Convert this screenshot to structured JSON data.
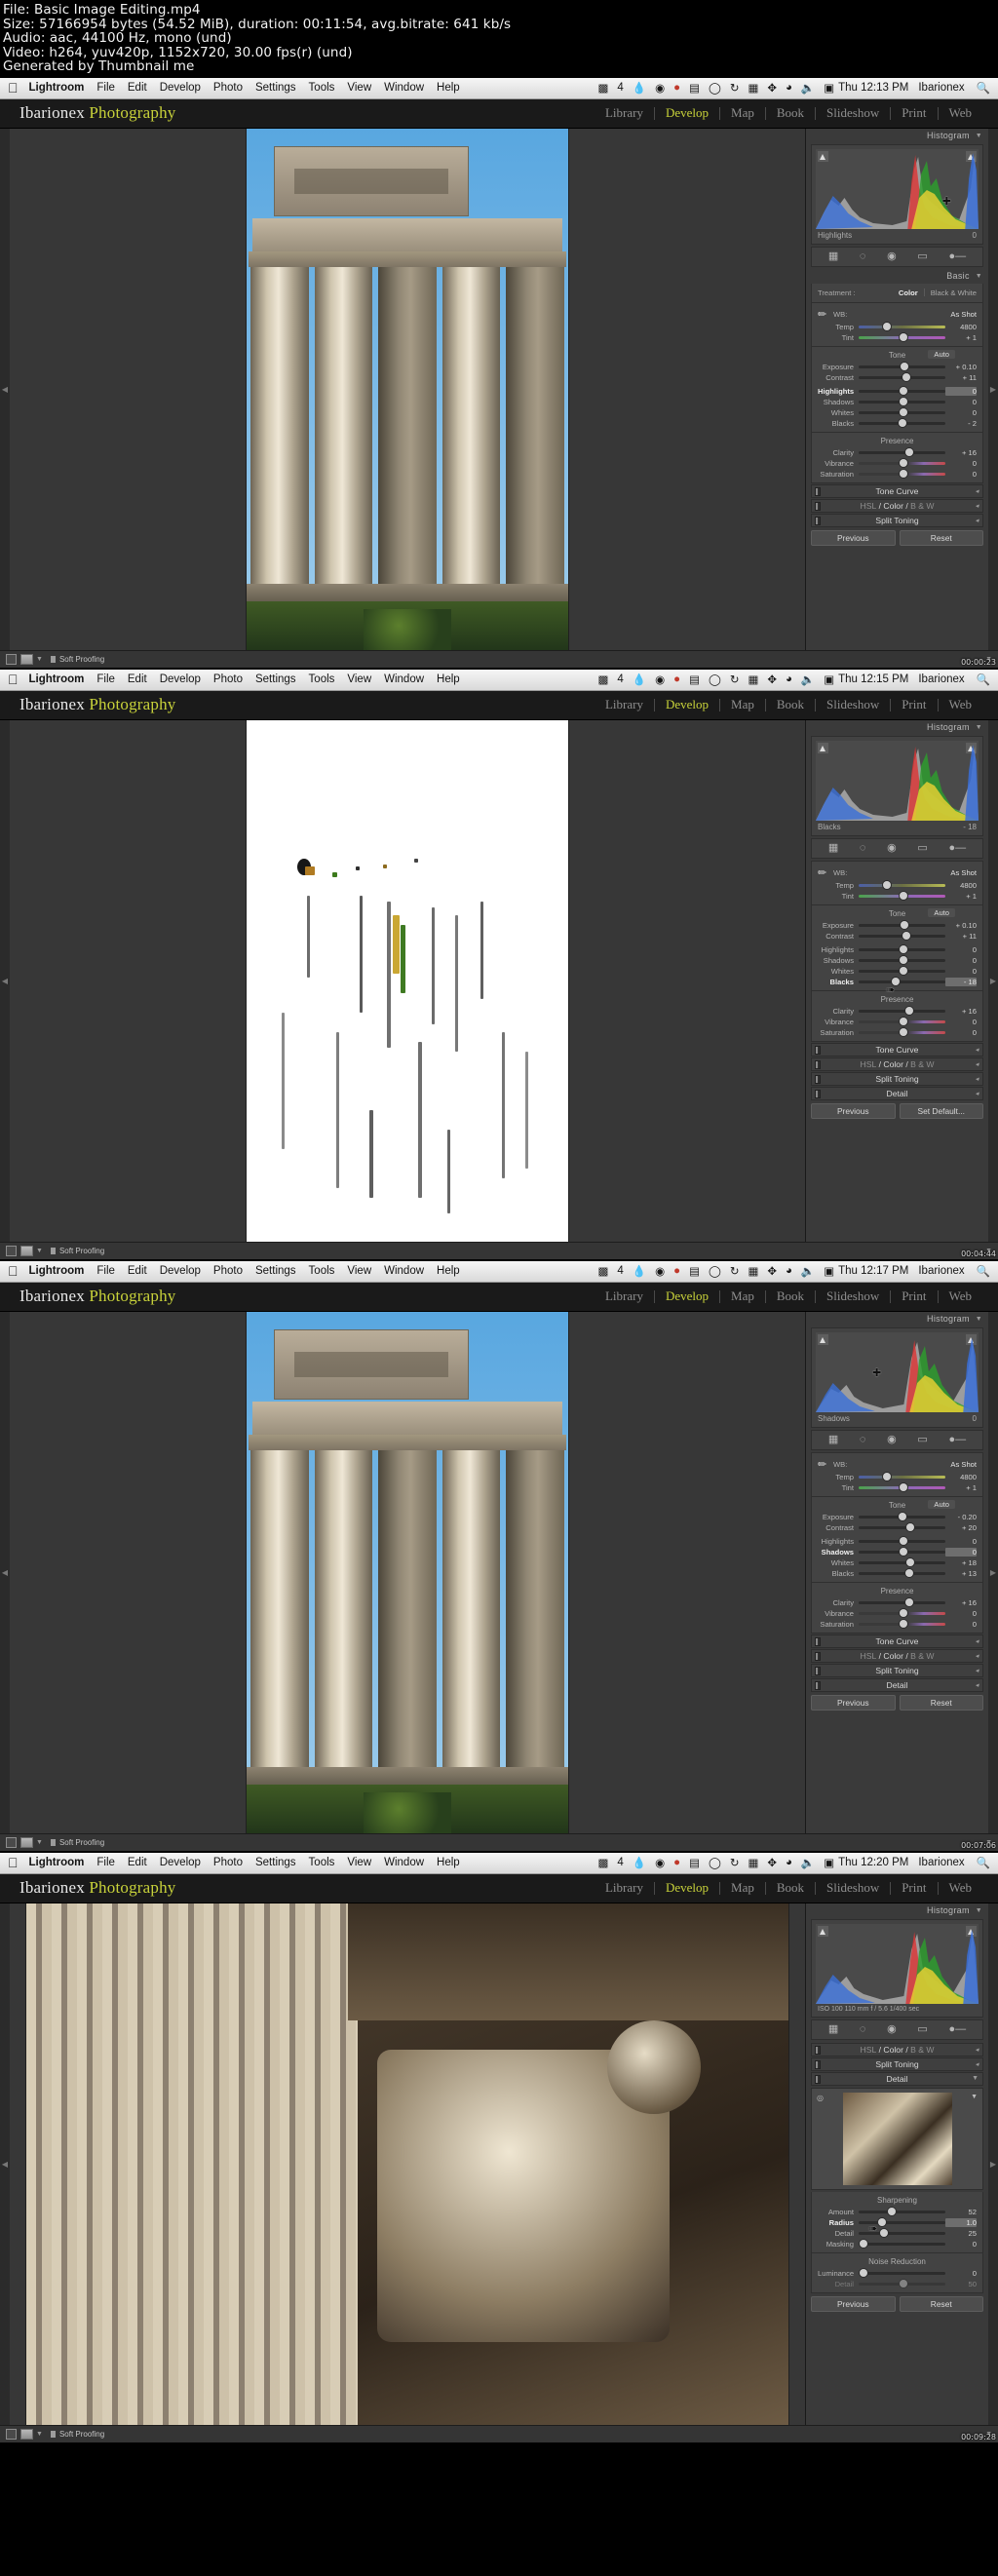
{
  "header": {
    "lines": [
      "File: Basic Image Editing.mp4",
      "Size: 57166954 bytes (54.52 MiB), duration: 00:11:54, avg.bitrate: 641 kb/s",
      "Audio: aac, 44100 Hz, mono (und)",
      "Video: h264, yuv420p, 1152x720, 30.00 fps(r) (und)",
      "Generated by Thumbnail me"
    ]
  },
  "macbar": {
    "apple": "apple-logo",
    "menus": [
      "Lightroom",
      "File",
      "Edit",
      "Develop",
      "Photo",
      "Settings",
      "Tools",
      "View",
      "Window",
      "Help"
    ],
    "tray_count": "4",
    "user": "Ibarionex",
    "search_icon": "search-icon"
  },
  "identity": {
    "word1": "Ibarionex",
    "word2": "Photography"
  },
  "modules": {
    "items": [
      "Library",
      "Develop",
      "Map",
      "Book",
      "Slideshow",
      "Print",
      "Web"
    ],
    "active": "Develop"
  },
  "labels": {
    "histogram": "Histogram",
    "basic": "Basic",
    "treatment": "Treatment :",
    "color": "Color",
    "bw": "Black & White",
    "wb": "WB:",
    "as_shot": "As Shot",
    "tone": "Tone",
    "auto": "Auto",
    "presence": "Presence",
    "temp": "Temp",
    "tint": "Tint",
    "exposure": "Exposure",
    "contrast": "Contrast",
    "highlights": "Highlights",
    "shadows": "Shadows",
    "whites": "Whites",
    "blacks": "Blacks",
    "clarity": "Clarity",
    "vibrance": "Vibrance",
    "saturation": "Saturation",
    "tone_curve": "Tone Curve",
    "hsl": "HSL",
    "bw_short": "B & W",
    "split_toning": "Split Toning",
    "detail": "Detail",
    "sharpening": "Sharpening",
    "amount": "Amount",
    "radius": "Radius",
    "detail_slider": "Detail",
    "masking": "Masking",
    "noise_reduction": "Noise Reduction",
    "luminance": "Luminance",
    "soft_proofing": "Soft Proofing",
    "previous": "Previous",
    "reset": "Reset",
    "set_default": "Set Default..."
  },
  "panels": [
    {
      "id": "panel-1",
      "clock": "Thu 12:13 PM",
      "timestamp": "00:00:23",
      "histogram_readout_label": "Highlights",
      "histogram_readout_value": "0",
      "photo": "columns-building",
      "basic": {
        "temp": "4800",
        "tint": "+ 1",
        "exposure": "+ 0.10",
        "contrast": "+ 11",
        "highlights": "0",
        "shadows": "0",
        "whites": "0",
        "blacks": "- 2",
        "clarity": "+ 16",
        "vibrance": "0",
        "saturation": "0",
        "highlighted_row": "highlights"
      },
      "footer_buttons": [
        "Previous",
        "Reset"
      ]
    },
    {
      "id": "panel-2",
      "clock": "Thu 12:15 PM",
      "timestamp": "00:04:44",
      "histogram_readout_label": "Blacks",
      "histogram_readout_value": "- 18",
      "photo": "clipping-preview",
      "basic": {
        "temp": "4800",
        "tint": "+ 1",
        "exposure": "+ 0.10",
        "contrast": "+ 11",
        "highlights": "0",
        "shadows": "0",
        "whites": "0",
        "blacks": "- 18",
        "clarity": "+ 16",
        "vibrance": "0",
        "saturation": "0",
        "highlighted_row": "blacks"
      },
      "footer_buttons": [
        "Previous",
        "Set Default..."
      ]
    },
    {
      "id": "panel-3",
      "clock": "Thu 12:17 PM",
      "timestamp": "00:07:06",
      "histogram_readout_label": "Shadows",
      "histogram_readout_value": "0",
      "photo": "columns-building",
      "basic": {
        "temp": "4800",
        "tint": "+ 1",
        "exposure": "- 0.20",
        "contrast": "+ 20",
        "highlights": "0",
        "shadows": "0",
        "whites": "+ 18",
        "blacks": "+ 13",
        "clarity": "+ 16",
        "vibrance": "0",
        "saturation": "0",
        "highlighted_row": "shadows"
      },
      "footer_buttons": [
        "Previous",
        "Reset"
      ]
    },
    {
      "id": "panel-4",
      "clock": "Thu 12:20 PM",
      "timestamp": "00:09:28",
      "histogram_exif": "ISO 100   110 mm   f / 5.6   1/400 sec",
      "photo": "capital-closeup",
      "detail": {
        "amount": "52",
        "radius": "1.0",
        "detail": "25",
        "masking": "0",
        "luminance": "0",
        "nr_detail": "50",
        "highlighted_row": "radius"
      },
      "footer_buttons": [
        "Previous",
        "Reset"
      ]
    }
  ]
}
